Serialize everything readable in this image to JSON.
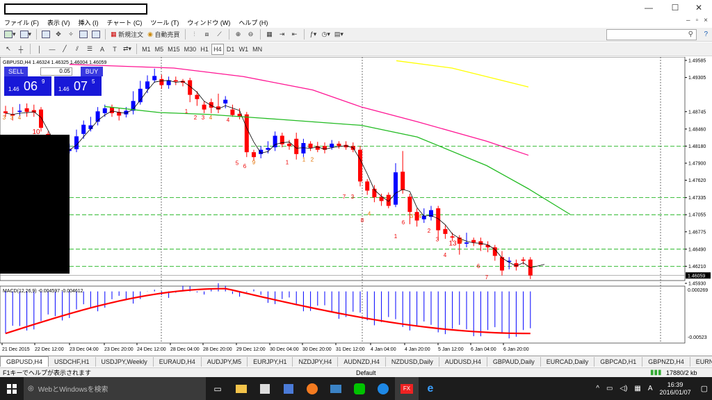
{
  "menu": [
    "ファイル (F)",
    "表示 (V)",
    "挿入 (I)",
    "チャート (C)",
    "ツール (T)",
    "ウィンドウ (W)",
    "ヘルプ (H)"
  ],
  "toolbar": {
    "new_order": "新規注文",
    "auto_trade": "自動売買"
  },
  "timeframes": [
    "M1",
    "M5",
    "M15",
    "M30",
    "H1",
    "H4",
    "D1",
    "W1",
    "MN"
  ],
  "chart": {
    "header": "GBPUSD,H4  1.46324 1.46325 1.46004 1.46059",
    "macd_label": "MACD(12,26,9) -0.004597 -0.004612",
    "current_price": "1.46059",
    "price_labels": [
      "1.49585",
      "1.49305",
      "1.48745",
      "1.48460",
      "1.48180",
      "1.47900",
      "1.47620",
      "1.47335",
      "1.47055",
      "1.46775",
      "1.46490",
      "1.46210",
      "1.45930"
    ],
    "macd_labels": [
      "0.000269",
      "-0.00523"
    ],
    "x_labels": [
      "21 Dec 2015",
      "22 Dec 12:00",
      "23 Dec 04:00",
      "23 Dec 20:00",
      "24 Dec 12:00",
      "28 Dec 04:00",
      "28 Dec 20:00",
      "29 Dec 12:00",
      "30 Dec 04:00",
      "30 Dec 20:00",
      "31 Dec 12:00",
      "4 Jan 04:00",
      "4 Jan 20:00",
      "5 Jan 12:00",
      "6 Jan 04:00",
      "6 Jan 20:00"
    ],
    "colors": {
      "bull": "#0000ff",
      "bear": "#ff0000",
      "ma_magenta": "#ff1493",
      "ma_green": "#22bb22",
      "ma_yellow": "#ffff00",
      "grid_dash": "#00aa00"
    }
  },
  "trade_panel": {
    "sell": "SELL",
    "buy": "BUY",
    "lot": "0.05",
    "sell_prefix": "1.46",
    "sell_big": "06",
    "sell_sup": "9",
    "buy_prefix": "1.46",
    "buy_big": "07",
    "buy_sup": "5"
  },
  "tabs": [
    "GBPUSD,H4",
    "USDCHF,H1",
    "USDJPY,Weekly",
    "EURAUD,H4",
    "AUDJPY,M5",
    "EURJPY,H1",
    "NZDJPY,H4",
    "AUDNZD,H4",
    "NZDUSD,Daily",
    "AUDUSD,H4",
    "GBPAUD,Daily",
    "EURCAD,Daily",
    "GBPCAD,H1",
    "GBPNZD,H4",
    "EURNZD,Dail"
  ],
  "status": {
    "help": "F1キーでヘルプが表示されます",
    "profile": "Default",
    "traffic": "17880/2 kb"
  },
  "taskbar": {
    "search": "WebとWindowsを検索",
    "time": "16:39",
    "date": "2016/01/07",
    "ime": "A"
  }
}
